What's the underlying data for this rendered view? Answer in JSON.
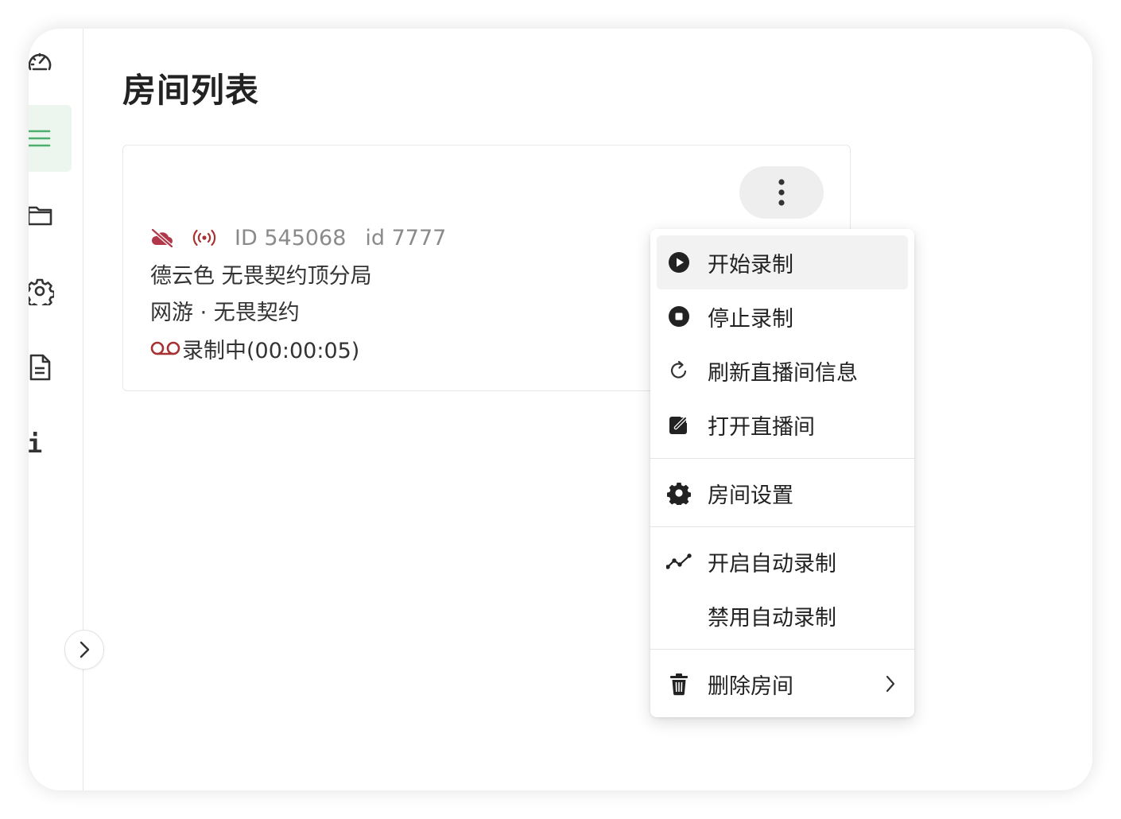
{
  "page": {
    "title": "房间列表"
  },
  "sidebar": {
    "items": [
      {
        "icon": "dashboard-gauge-icon"
      },
      {
        "icon": "menu-list-icon",
        "active": true
      },
      {
        "icon": "folder-icon"
      },
      {
        "icon": "gear-icon"
      },
      {
        "icon": "document-icon"
      },
      {
        "icon": "info-icon",
        "glyph": "i"
      }
    ],
    "expand_icon": "chevron-right-icon"
  },
  "room": {
    "meta": {
      "room_id": "ID 545068",
      "user_id": "id 7777"
    },
    "title": "德云色 无畏契约顶分局",
    "category": "网游 · 无畏契约",
    "status": "录制中(00:00:05)",
    "status_icon": "voicemail-icon",
    "icons": [
      "cloud-off-icon",
      "broadcast-icon"
    ]
  },
  "menu": {
    "items": [
      {
        "label": "开始录制",
        "icon": "play-circle-icon"
      },
      {
        "label": "停止录制",
        "icon": "stop-circle-icon"
      },
      {
        "label": "刷新直播间信息",
        "icon": "refresh-icon"
      },
      {
        "label": "打开直播间",
        "icon": "open-external-icon"
      },
      {
        "label": "房间设置",
        "icon": "gear-icon"
      },
      {
        "label": "开启自动录制",
        "icon": "trend-line-icon"
      },
      {
        "label": "禁用自动录制",
        "icon": ""
      },
      {
        "label": "删除房间",
        "icon": "trash-icon",
        "has_submenu": true
      }
    ]
  },
  "colors": {
    "accent": "#4caf6e",
    "active_bg": "#edf5ef",
    "danger": "#a83232"
  }
}
